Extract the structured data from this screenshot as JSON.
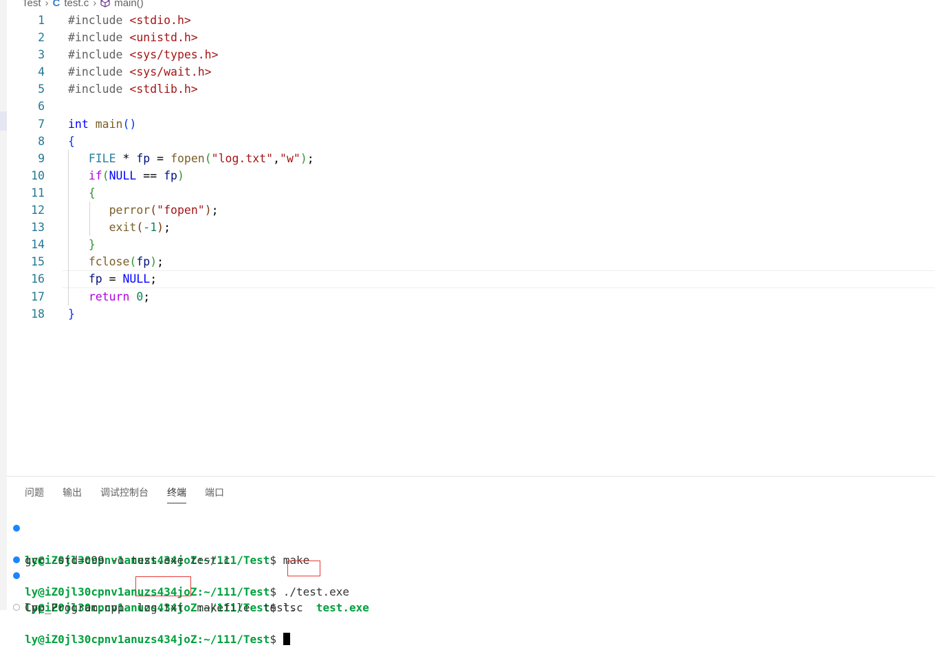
{
  "breadcrumb": {
    "folder": "Test",
    "file": "test.c",
    "symbol": "main()"
  },
  "editor": {
    "lines": [
      {
        "n": "1"
      },
      {
        "n": "2"
      },
      {
        "n": "3"
      },
      {
        "n": "4"
      },
      {
        "n": "5"
      },
      {
        "n": "6"
      },
      {
        "n": "7"
      },
      {
        "n": "8"
      },
      {
        "n": "9"
      },
      {
        "n": "10"
      },
      {
        "n": "11"
      },
      {
        "n": "12"
      },
      {
        "n": "13"
      },
      {
        "n": "14"
      },
      {
        "n": "15"
      },
      {
        "n": "16"
      },
      {
        "n": "17"
      },
      {
        "n": "18"
      }
    ],
    "code": {
      "inc": "#include ",
      "h1": "<stdio.h>",
      "h2": "<unistd.h>",
      "h3": "<sys/types.h>",
      "h4": "<sys/wait.h>",
      "h5": "<stdlib.h>",
      "int": "int",
      "main": "main",
      "paren_open": "(",
      "paren_close": ")",
      "brace_open": "{",
      "brace_close": "}",
      "FILE": "FILE",
      "star_fp": " * ",
      "fp": "fp",
      "eq": " = ",
      "fopen": "fopen",
      "str_log": "\"log.txt\"",
      "comma": ",",
      "str_w": "\"w\"",
      "semi": ";",
      "if": "if",
      "NULL": "NULL",
      "eqeq": " == ",
      "perror": "perror",
      "str_fopen": "\"fopen\"",
      "exit": "exit",
      "neg1": "-1",
      "fclose": "fclose",
      "return": "return",
      "zero": "0"
    }
  },
  "panel": {
    "tabs": [
      "问题",
      "输出",
      "调试控制台",
      "终端",
      "端口"
    ],
    "active_tab": "终端"
  },
  "terminal": {
    "user_host": "ly@iZ0jl30cpnv1anuzs434joZ",
    "path": "~/111/Test",
    "dollar": "$ ",
    "lines": {
      "cmd1": "make",
      "out1": "gcc -std=c99 -o test.exe test.c",
      "cmd2": "./test.exe",
      "cmd3": "ls",
      "ls_cpp": "Cpp_Program.cpp",
      "ls_log": "log.txt",
      "ls_make": "makefile",
      "ls_testc": "test.c",
      "ls_exe": "test.exe"
    }
  },
  "colors": {
    "accent": "#1a85ff",
    "highlight_box": "#e53935"
  }
}
